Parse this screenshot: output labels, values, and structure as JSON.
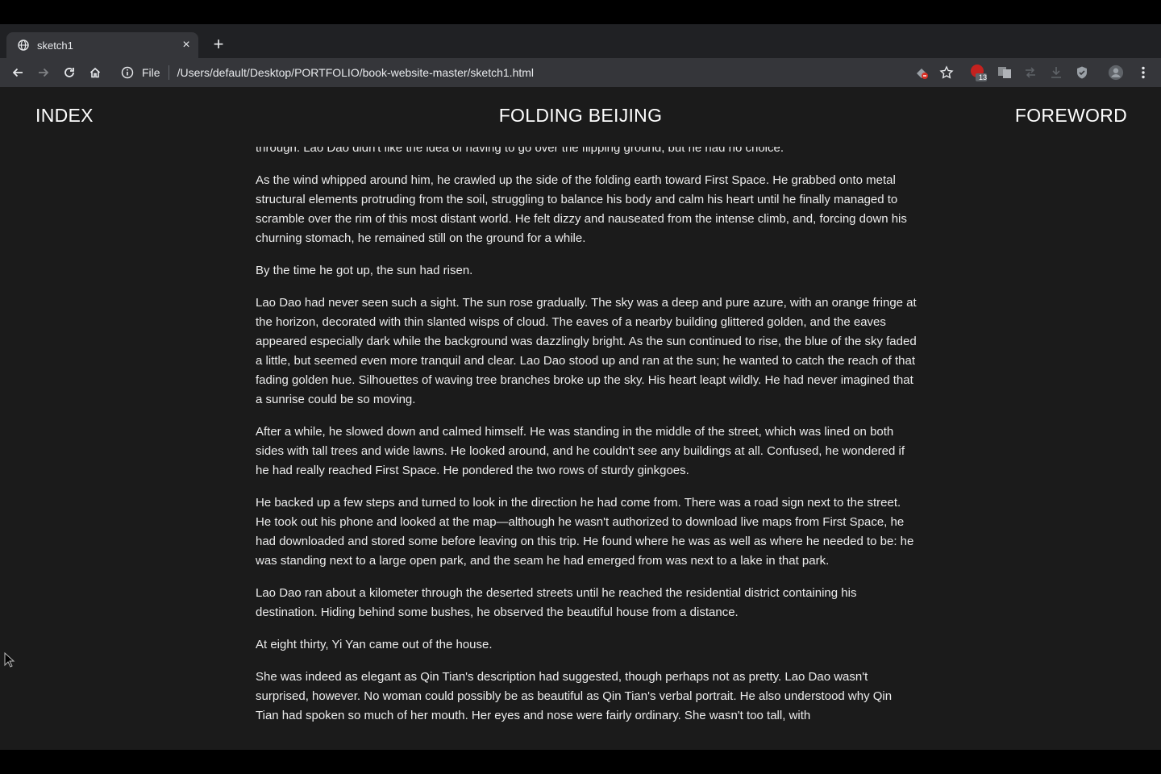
{
  "browser": {
    "tab_title": "sketch1",
    "tab_close": "×",
    "new_tab": "+",
    "scheme_label": "File",
    "url": "/Users/default/Desktop/PORTFOLIO/book-website-master/sketch1.html",
    "extension_badge": "13"
  },
  "nav": {
    "index": "INDEX",
    "title": "FOLDING BEIJING",
    "foreword": "FOREWORD"
  },
  "story": {
    "paragraphs": [
      "through. Lao Dao didn't like the idea of having to go over the flipping ground, but he had no choice.",
      "As the wind whipped around him, he crawled up the side of the folding earth toward First Space. He grabbed onto metal structural elements protruding from the soil, struggling to balance his body and calm his heart until he finally managed to scramble over the rim of this most distant world. He felt dizzy and nauseated from the intense climb, and, forcing down his churning stomach, he remained still on the ground for a while.",
      "By the time he got up, the sun had risen.",
      "Lao Dao had never seen such a sight. The sun rose gradually. The sky was a deep and pure azure, with an orange fringe at the horizon, decorated with thin slanted wisps of cloud. The eaves of a nearby building glittered golden, and the eaves appeared especially dark while the background was dazzlingly bright. As the sun continued to rise, the blue of the sky faded a little, but seemed even more tranquil and clear. Lao Dao stood up and ran at the sun; he wanted to catch the reach of that fading golden hue. Silhouettes of waving tree branches broke up the sky. His heart leapt wildly. He had never imagined that a sunrise could be so moving.",
      "After a while, he slowed down and calmed himself. He was standing in the middle of the street, which was lined on both sides with tall trees and wide lawns. He looked around, and he couldn't see any buildings at all. Confused, he wondered if he had really reached First Space. He pondered the two rows of sturdy ginkgoes.",
      "He backed up a few steps and turned to look in the direction he had come from. There was a road sign next to the street. He took out his phone and looked at the map—although he wasn't authorized to download live maps from First Space, he had downloaded and stored some before leaving on this trip. He found where he was as well as where he needed to be: he was standing next to a large open park, and the seam he had emerged from was next to a lake in that park.",
      "Lao Dao ran about a kilometer through the deserted streets until he reached the residential district containing his destination. Hiding behind some bushes, he observed the beautiful house from a distance.",
      "At eight thirty, Yi Yan came out of the house.",
      "She was indeed as elegant as Qin Tian's description had suggested, though perhaps not as pretty. Lao Dao wasn't surprised, however. No woman could possibly be as beautiful as Qin Tian's verbal portrait. He also understood why Qin Tian had spoken so much of her mouth. Her eyes and nose were fairly ordinary. She wasn't too tall, with"
    ]
  }
}
